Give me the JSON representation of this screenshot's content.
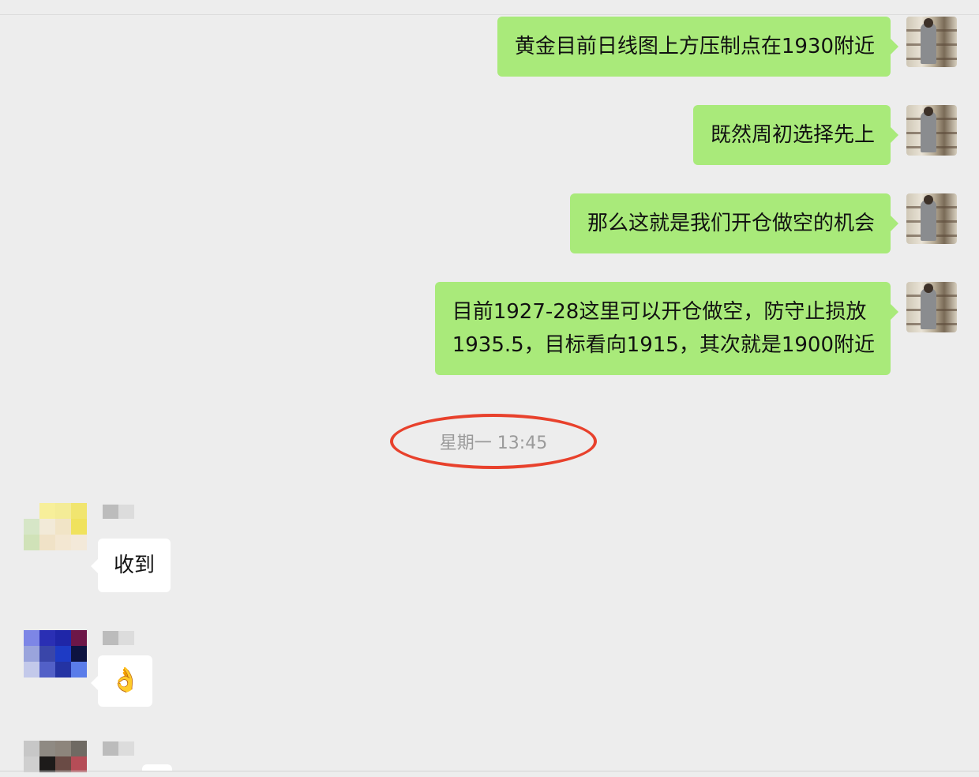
{
  "outgoing_messages": [
    {
      "text": "黄金目前日线图上方压制点在1930附近"
    },
    {
      "text": "既然周初选择先上"
    },
    {
      "text": "那么这就是我们开仓做空的机会"
    },
    {
      "line1": "目前1927-28这里可以开仓做空，防守止损放",
      "line2": "1935.5，目标看向1915，其次就是1900附近"
    }
  ],
  "timestamp": "星期一 13:45",
  "incoming_messages": [
    {
      "text": "收到"
    },
    {
      "text": "👌"
    }
  ],
  "colors": {
    "outgoing_bubble": "#a9ea7a",
    "incoming_bubble": "#ffffff",
    "background": "#ededed",
    "highlight_ring": "#e8412c",
    "timestamp_text": "#9a9a9a"
  }
}
